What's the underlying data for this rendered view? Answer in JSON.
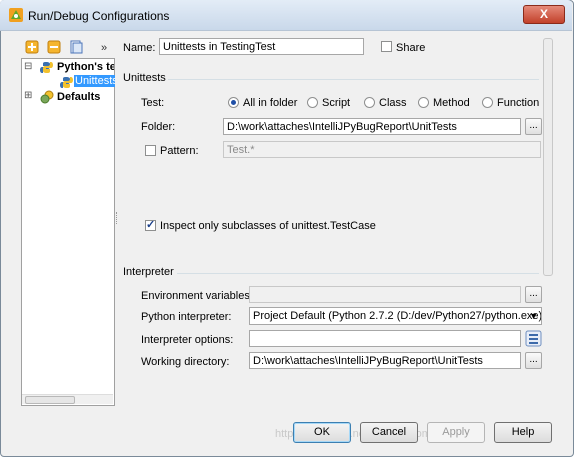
{
  "window": {
    "title": "Run/Debug Configurations",
    "close_label": "X"
  },
  "toolbar": {
    "more_label": "»"
  },
  "tree": {
    "items": [
      {
        "label": "Python's te",
        "expander": "⊟"
      },
      {
        "label": "Unittests"
      },
      {
        "label": "Defaults",
        "expander": "⊞"
      }
    ]
  },
  "form": {
    "name_label": "Name:",
    "name_value": "Unittests in TestingTest",
    "share_label": "Share",
    "unittests_section": "Unittests",
    "test_label": "Test:",
    "test_options": [
      "All in folder",
      "Script",
      "Class",
      "Method",
      "Function"
    ],
    "test_selected": "All in folder",
    "folder_label": "Folder:",
    "folder_value": "D:\\work\\attaches\\IntelliJPyBugReport\\UnitTests",
    "pattern_label": "Pattern:",
    "pattern_value": "Test.*",
    "inspect_label": "Inspect only subclasses of unittest.TestCase",
    "interpreter_section": "Interpreter",
    "env_label": "Environment variables:",
    "env_value": "",
    "python_interp_label": "Python interpreter:",
    "python_interp_value": "Project Default (Python 2.7.2 (D:/dev/Python27/python.exe))",
    "interp_options_label": "Interpreter options:",
    "interp_options_value": "",
    "working_dir_label": "Working directory:",
    "working_dir_value": "D:\\work\\attaches\\IntelliJPyBugReport\\UnitTests",
    "browse_label": "..."
  },
  "buttons": {
    "ok": "OK",
    "cancel": "Cancel",
    "apply": "Apply",
    "help": "Help"
  },
  "watermark": "http://blog.csdn.net/moxiaomomo"
}
